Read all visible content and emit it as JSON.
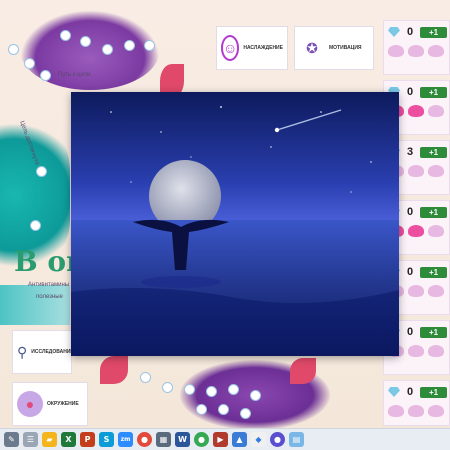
{
  "board": {
    "path_label": "Путь к цели",
    "side_label": "Цель достигнута",
    "big_text": "В ок",
    "small_text_1": "Антивитамины",
    "small_text_2": "полезные"
  },
  "cards": {
    "pleasure": "НАСЛАЖДЕНИЕ",
    "motivation": "МОТИВАЦИЯ",
    "research": "ИССЛЕДОВАНИЕ",
    "environment": "ОКРУЖЕНИЕ"
  },
  "counters": [
    {
      "value": "0",
      "plus": "+1",
      "whales": [
        "off",
        "off",
        "off"
      ]
    },
    {
      "value": "0",
      "plus": "+1",
      "whales": [
        "hot",
        "hot",
        "off"
      ]
    },
    {
      "value": "3",
      "plus": "+1",
      "whales": [
        "off",
        "off",
        "off"
      ]
    },
    {
      "value": "0",
      "plus": "+1",
      "whales": [
        "off",
        "off",
        "off"
      ]
    },
    {
      "value": "0",
      "plus": "+1",
      "whales": [
        "off",
        "off",
        "off"
      ]
    },
    {
      "value": "0",
      "plus": "+1",
      "whales": [
        "off",
        "off",
        "off"
      ]
    },
    {
      "value": "0",
      "plus": "+1",
      "whales": [
        "off",
        "off",
        "off"
      ]
    }
  ],
  "taskbar": {
    "icons": [
      "app-menu-icon",
      "file-explorer-icon",
      "excel-icon",
      "powerpoint-icon",
      "skype-icon",
      "zoom-icon",
      "chrome-icon",
      "calculator-icon",
      "word-icon",
      "chrome-2-icon",
      "video-icon",
      "photos-icon",
      "browser-icon",
      "miro-icon"
    ],
    "colors": [
      "#6b7a8c",
      "#f3b51b",
      "#1f7a3a",
      "#c43e1c",
      "#0b9bd7",
      "#2d8cff",
      "#e24a3b",
      "#5a6b7d",
      "#2b579a",
      "#34a853",
      "#b03a2e",
      "#3a7bd5",
      "#5a4fcf",
      "#f2c94c"
    ]
  },
  "colors": {
    "teal": "#0d9a99",
    "purple": "#7b3aa1",
    "pink": "#e0496a",
    "counter_green": "#2e8b3a"
  }
}
